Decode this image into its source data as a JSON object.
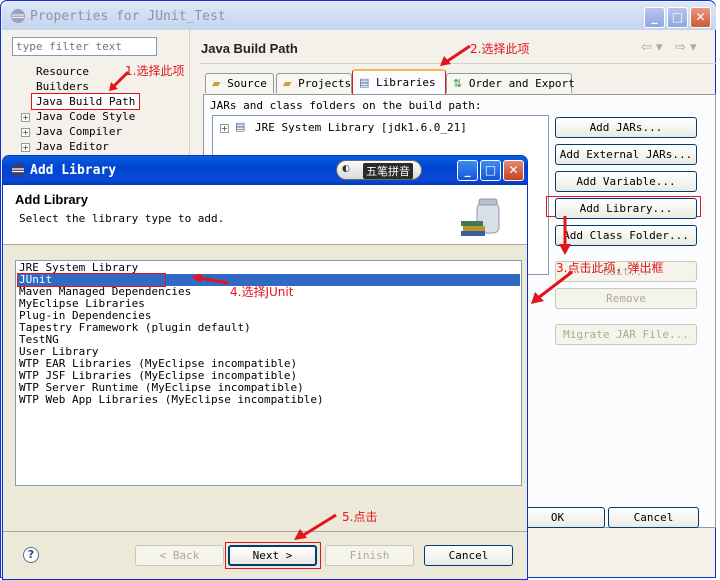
{
  "outer": {
    "title": "Properties for JUnit_Test",
    "filter_placeholder": "type filter text",
    "tree": [
      "Resource",
      "Builders",
      "Java Build Path",
      "Java Code Style",
      "Java Compiler",
      "Java Editor"
    ],
    "page_title": "Java Build Path",
    "tabs": [
      "Source",
      "Projects",
      "Libraries",
      "Order and Export"
    ],
    "jars_label": "JARs and class folders on the build path:",
    "jre_entry": "JRE System Library [jdk1.6.0_21]",
    "buttons": {
      "add_jars": "Add JARs...",
      "add_external_jars": "Add External JARs...",
      "add_variable": "Add Variable...",
      "add_library": "Add Library...",
      "add_class_folder": "Add Class Folder...",
      "edit": "Edit...",
      "remove": "Remove",
      "migrate": "Migrate JAR File...",
      "ok": "OK",
      "cancel": "Cancel"
    }
  },
  "dialog": {
    "title": "Add Library",
    "ime_label": "五笔拼音",
    "banner_title": "Add Library",
    "banner_desc": "Select the library type to add.",
    "libraries": [
      "JRE System Library",
      "JUnit",
      "Maven Managed Dependencies",
      "MyEclipse Libraries",
      "Plug-in Dependencies",
      "Tapestry Framework (plugin default)",
      "TestNG",
      "User Library",
      "WTP EAR Libraries (MyEclipse incompatible)",
      "WTP JSF Libraries (MyEclipse incompatible)",
      "WTP Server Runtime (MyEclipse incompatible)",
      "WTP Web App Libraries (MyEclipse incompatible)"
    ],
    "selected_index": 1,
    "buttons": {
      "back": "< Back",
      "next": "Next >",
      "finish": "Finish",
      "cancel": "Cancel"
    },
    "help": "?"
  },
  "annotations": {
    "step1": "1.选择此项",
    "step2": "2.选择此项",
    "step3": "3.点击此项，弹出框",
    "step4": "4.选择JUnit",
    "step5": "5.点击"
  },
  "colors": {
    "annotation": "#e2151c",
    "selection": "#316ac5",
    "title_active": "#0a4fd6"
  }
}
